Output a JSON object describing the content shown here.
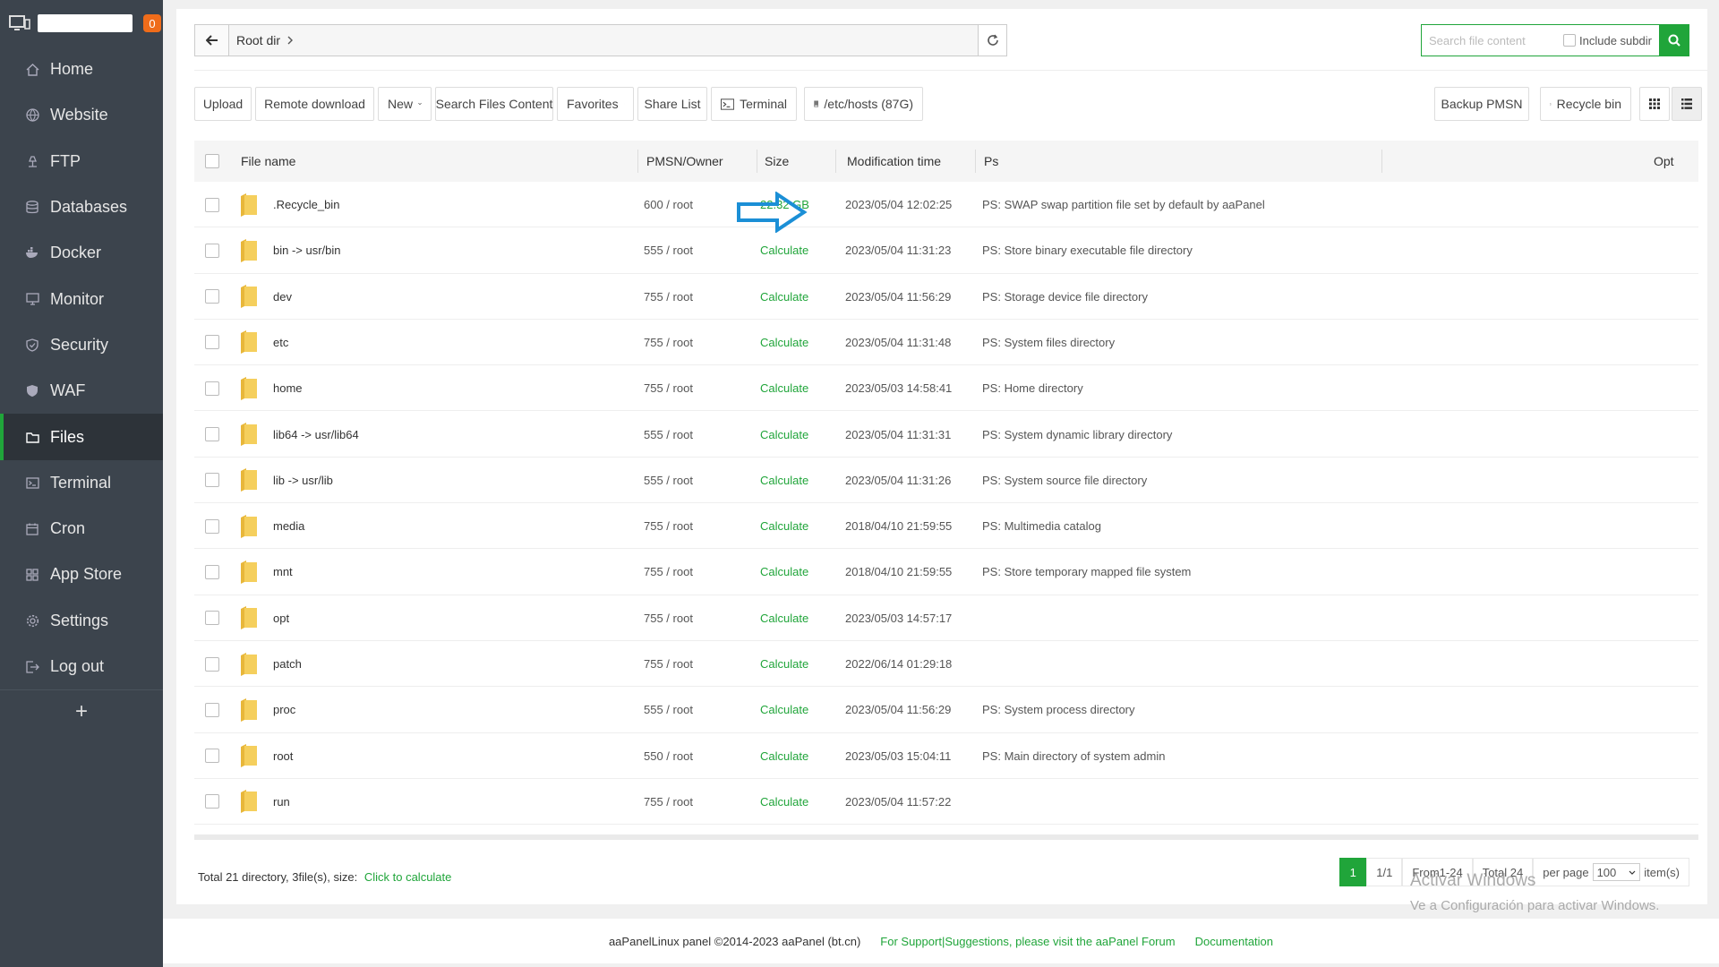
{
  "sidebar": {
    "badge": "0",
    "items": [
      {
        "label": "Home",
        "icon": "home-icon"
      },
      {
        "label": "Website",
        "icon": "globe-icon"
      },
      {
        "label": "FTP",
        "icon": "ftp-icon"
      },
      {
        "label": "Databases",
        "icon": "database-icon"
      },
      {
        "label": "Docker",
        "icon": "docker-icon"
      },
      {
        "label": "Monitor",
        "icon": "monitor-icon"
      },
      {
        "label": "Security",
        "icon": "shield-icon"
      },
      {
        "label": "WAF",
        "icon": "waf-shield-icon"
      },
      {
        "label": "Files",
        "icon": "folder-icon"
      },
      {
        "label": "Terminal",
        "icon": "terminal-icon"
      },
      {
        "label": "Cron",
        "icon": "calendar-icon"
      },
      {
        "label": "App Store",
        "icon": "grid-icon"
      },
      {
        "label": "Settings",
        "icon": "gear-icon"
      },
      {
        "label": "Log out",
        "icon": "logout-icon"
      }
    ],
    "active": "Files",
    "add": "+"
  },
  "path": {
    "root": "Root dir"
  },
  "search": {
    "placeholder": "Search file content",
    "subdir_label": "Include subdir"
  },
  "toolbar": {
    "upload": "Upload",
    "remote_download": "Remote download",
    "new": "New",
    "search_files": "Search Files Content",
    "favorites": "Favorites",
    "share_list": "Share List",
    "terminal": "Terminal",
    "hosts": "/etc/hosts (87G)",
    "backup": "Backup PMSN",
    "recycle": "Recycle bin"
  },
  "table": {
    "headers": {
      "name": "File name",
      "perm": "PMSN/Owner",
      "size": "Size",
      "mtime": "Modification time",
      "ps": "Ps",
      "opt": "Opt"
    },
    "rows": [
      {
        "name": ".Recycle_bin",
        "perm": "600 / root",
        "size": "22.32 GB",
        "mtime": "2023/05/04 12:02:25",
        "ps": "PS: SWAP swap partition file set by default by aaPanel"
      },
      {
        "name": "bin -> usr/bin",
        "perm": "555 / root",
        "size": "Calculate",
        "mtime": "2023/05/04 11:31:23",
        "ps": "PS: Store binary executable file directory"
      },
      {
        "name": "dev",
        "perm": "755 / root",
        "size": "Calculate",
        "mtime": "2023/05/04 11:56:29",
        "ps": "PS: Storage device file directory"
      },
      {
        "name": "etc",
        "perm": "755 / root",
        "size": "Calculate",
        "mtime": "2023/05/04 11:31:48",
        "ps": "PS: System files directory"
      },
      {
        "name": "home",
        "perm": "755 / root",
        "size": "Calculate",
        "mtime": "2023/05/03 14:58:41",
        "ps": "PS: Home directory"
      },
      {
        "name": "lib64 -> usr/lib64",
        "perm": "555 / root",
        "size": "Calculate",
        "mtime": "2023/05/04 11:31:31",
        "ps": "PS:  System dynamic library directory"
      },
      {
        "name": "lib -> usr/lib",
        "perm": "555 / root",
        "size": "Calculate",
        "mtime": "2023/05/04 11:31:26",
        "ps": "PS: System source file directory"
      },
      {
        "name": "media",
        "perm": "755 / root",
        "size": "Calculate",
        "mtime": "2018/04/10 21:59:55",
        "ps": "PS:  Multimedia catalog"
      },
      {
        "name": "mnt",
        "perm": "755 / root",
        "size": "Calculate",
        "mtime": "2018/04/10 21:59:55",
        "ps": "PS: Store temporary mapped file system"
      },
      {
        "name": "opt",
        "perm": "755 / root",
        "size": "Calculate",
        "mtime": "2023/05/03 14:57:17",
        "ps": ""
      },
      {
        "name": "patch",
        "perm": "755 / root",
        "size": "Calculate",
        "mtime": "2022/06/14 01:29:18",
        "ps": ""
      },
      {
        "name": "proc",
        "perm": "555 / root",
        "size": "Calculate",
        "mtime": "2023/05/04 11:56:29",
        "ps": "PS:  System process directory"
      },
      {
        "name": "root",
        "perm": "550 / root",
        "size": "Calculate",
        "mtime": "2023/05/03 15:04:11",
        "ps": "PS: Main directory of system admin"
      },
      {
        "name": "run",
        "perm": "755 / root",
        "size": "Calculate",
        "mtime": "2023/05/04 11:57:22",
        "ps": ""
      }
    ]
  },
  "footer": {
    "stats": "Total 21 directory, 3file(s), size:",
    "calc_link": "Click to calculate"
  },
  "pager": {
    "current": "1",
    "pages": "1/1",
    "range": "From1-24",
    "total": "Total 24",
    "per_page_label": "per page",
    "per_page": "100",
    "items": "item(s)"
  },
  "watermark": {
    "line1": "Activar Windows",
    "line2": "Ve a Configuración para activar Windows."
  },
  "site_footer": {
    "copyright": "aaPanelLinux panel ©2014-2023 aaPanel (bt.cn)",
    "support": "For Support|Suggestions, please visit the aaPanel Forum",
    "docs": "Documentation"
  },
  "colors": {
    "accent": "#20a53a",
    "sidebar": "#3c444d",
    "badge": "#ef6c1a",
    "arrow": "#1b8fd6"
  }
}
